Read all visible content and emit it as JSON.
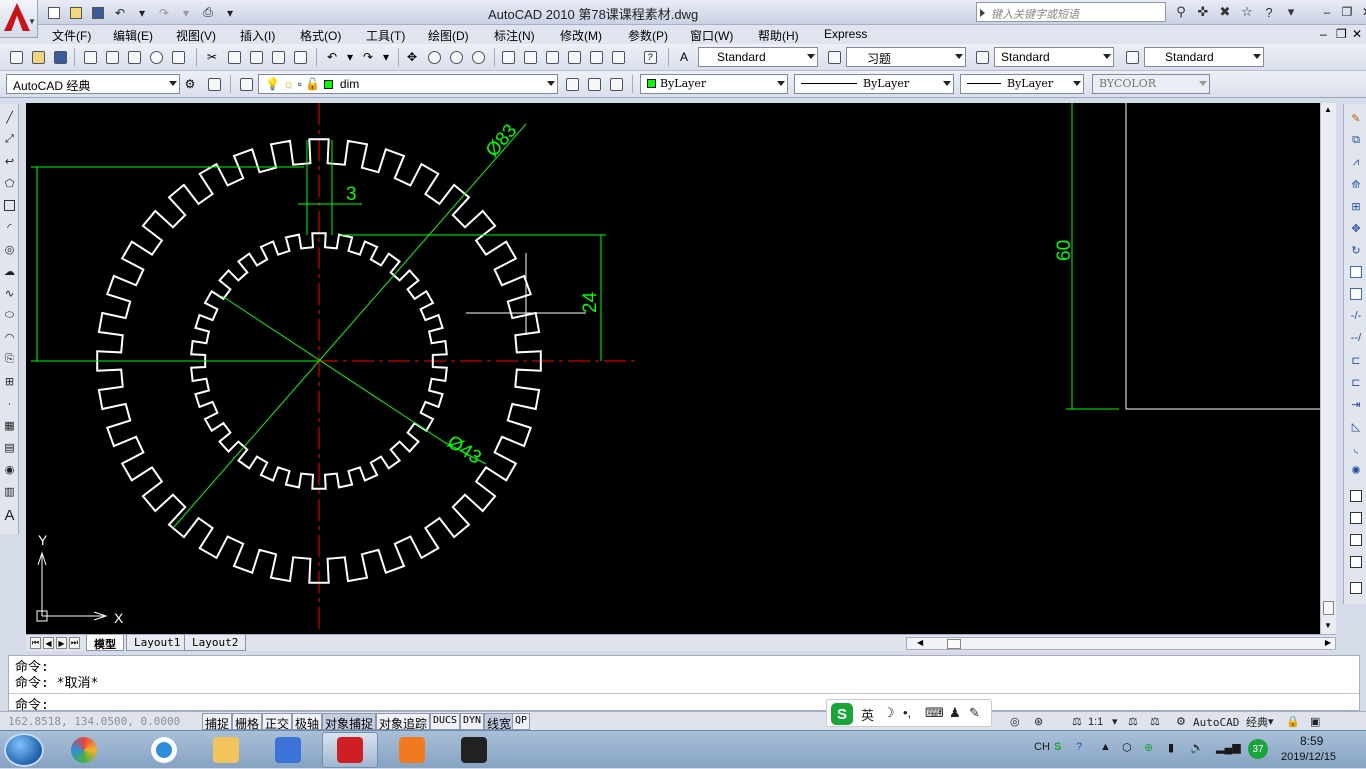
{
  "window": {
    "title": "AutoCAD 2010    第78课课程素材.dwg",
    "search_placeholder": "键入关键字或短语"
  },
  "menu": [
    "文件(F)",
    "编辑(E)",
    "视图(V)",
    "插入(I)",
    "格式(O)",
    "工具(T)",
    "绘图(D)",
    "标注(N)",
    "修改(M)",
    "参数(P)",
    "窗口(W)",
    "帮助(H)",
    "Express"
  ],
  "styles": {
    "text_style": "Standard",
    "dim_style": "习题",
    "table_style": "Standard",
    "multileader_style": "Standard"
  },
  "workspace": "AutoCAD 经典",
  "layer": {
    "name": "dim",
    "color": "#00ff00"
  },
  "properties": {
    "color": "ByLayer",
    "linetype": "ByLayer",
    "lineweight": "ByLayer",
    "plotstyle": "BYCOLOR"
  },
  "drawing": {
    "dimensions": [
      "Ø83",
      "3",
      "24",
      "Ø43",
      "60"
    ],
    "ucs_x": "X",
    "ucs_y": "Y",
    "outer_teeth": 36,
    "inner_teeth": 30,
    "colors": {
      "gear": "#ffffff",
      "dimension": "#00ff00",
      "centerline": "#ff0000",
      "background": "#000000"
    }
  },
  "tabs": [
    "模型",
    "Layout1",
    "Layout2"
  ],
  "command": {
    "line1": "命令:",
    "line2": "命令: *取消*",
    "prompt": "命令:"
  },
  "status": {
    "coords": "162.8518, 134.0500, 0.0000",
    "toggles": [
      "捕捉",
      "栅格",
      "正交",
      "极轴",
      "对象捕捉",
      "对象追踪",
      "DUCS",
      "DYN",
      "线宽",
      "QP"
    ],
    "scale": "1:1",
    "workspace": "AutoCAD 经典"
  },
  "ime": {
    "mode": "英"
  },
  "tray": {
    "lang": "CH",
    "badge": "37",
    "time": "8:59",
    "date": "2019/12/15"
  }
}
